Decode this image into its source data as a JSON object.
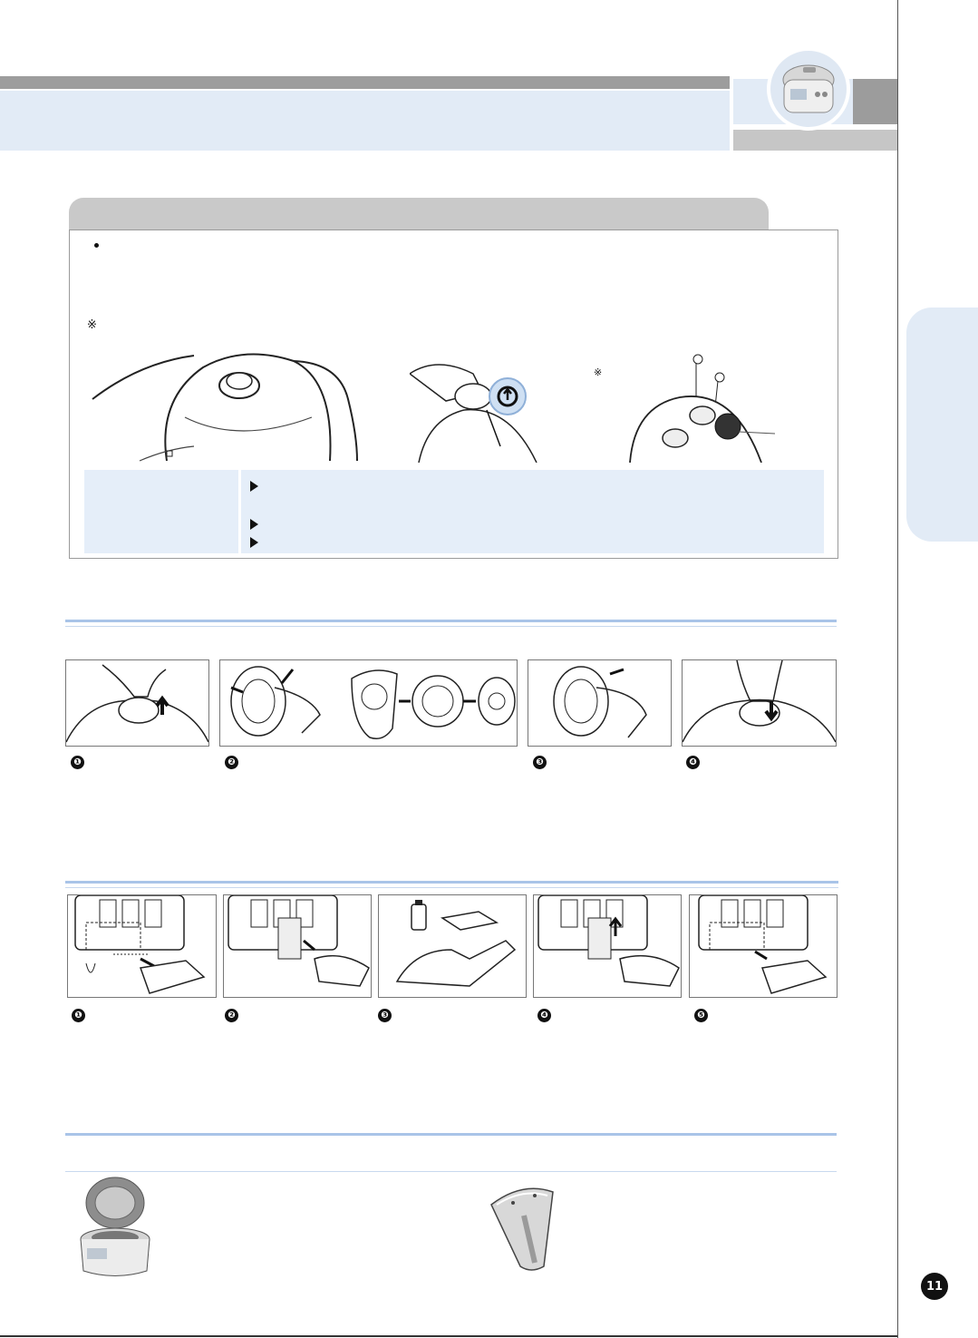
{
  "page": {
    "number": "11"
  },
  "info_box": {
    "bullet": "•",
    "note_mark": "※",
    "note_mark_small": "※",
    "check_markers": [
      "▶",
      "▶",
      "▶"
    ]
  },
  "section_cover": {
    "steps": [
      "❶",
      "❷",
      "❸",
      "❹"
    ]
  },
  "section_dew": {
    "steps": [
      "❶",
      "❷",
      "❸",
      "❹",
      "❺"
    ]
  },
  "icons": [
    "bullet-icon",
    "reference-mark-icon",
    "triangle-marker-icon",
    "circled-number-icon",
    "product-thumbnail-icon"
  ],
  "colors": {
    "header_band": "#e2ebf6",
    "header_gray": "#9d9d9d",
    "rule_blue": "#a9c4e8",
    "panel_blue": "#e5eef9"
  }
}
